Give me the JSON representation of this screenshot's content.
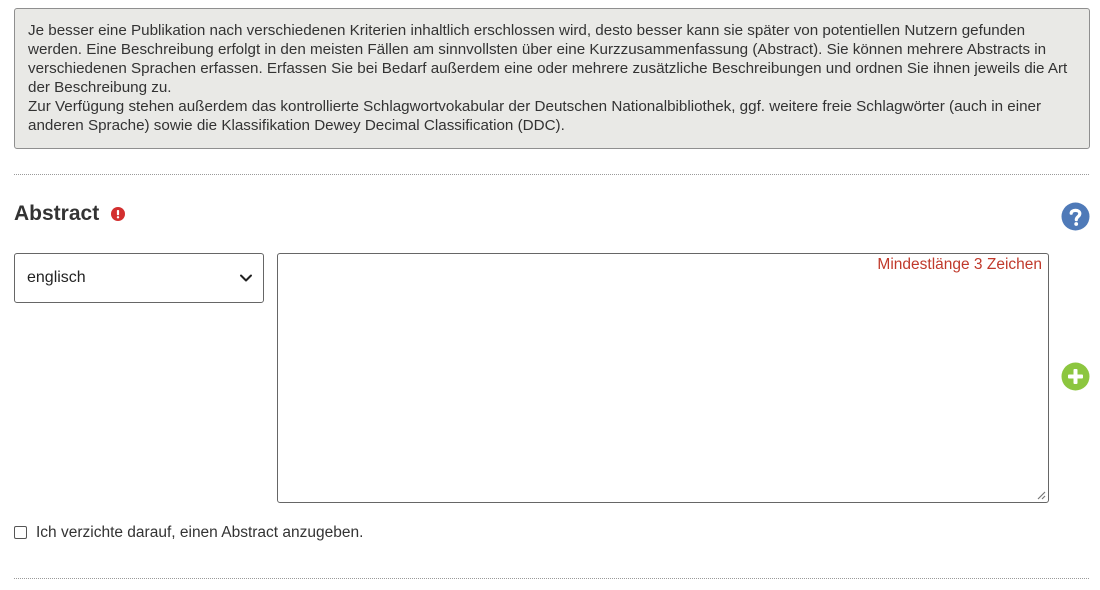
{
  "info": {
    "line1": "Je besser eine Publikation nach verschiedenen Kriterien inhaltlich erschlossen wird, desto besser kann sie später von potentiellen Nutzern gefunden werden. Eine Beschreibung erfolgt in den meisten Fällen am sinnvollsten über eine Kurzzusammenfassung (Abstract). Sie können mehrere Abstracts in verschiedenen Sprachen erfassen. Erfassen Sie bei Bedarf außerdem eine oder mehrere zusätzliche Beschreibungen und ordnen Sie ihnen jeweils die Art der Beschreibung zu.",
    "line2": "Zur Verfügung stehen außerdem das kontrollierte Schlagwortvokabular der Deutschen Nationalbibliothek, ggf. weitere freie Schlagwörter (auch in einer anderen Sprache) sowie die Klassifikation Dewey Decimal Classification (DDC)."
  },
  "abstract_section": {
    "title": "Abstract",
    "required_icon": "exclamation-circle-icon",
    "help_icon": "question-circle-icon",
    "language_select": {
      "selected": "englisch"
    },
    "textarea": {
      "value": "",
      "validation_message": "Mindestlänge 3 Zeichen"
    },
    "add_icon": "plus-circle-icon",
    "waive_checkbox": {
      "checked": false,
      "label": "Ich verzichte darauf, einen Abstract anzugeben."
    }
  },
  "colors": {
    "info_background": "#e9e9e6",
    "required_red": "#d32f2f",
    "help_blue": "#4f7ab8",
    "add_green": "#8cc63f",
    "validation_red": "#c0392b"
  }
}
